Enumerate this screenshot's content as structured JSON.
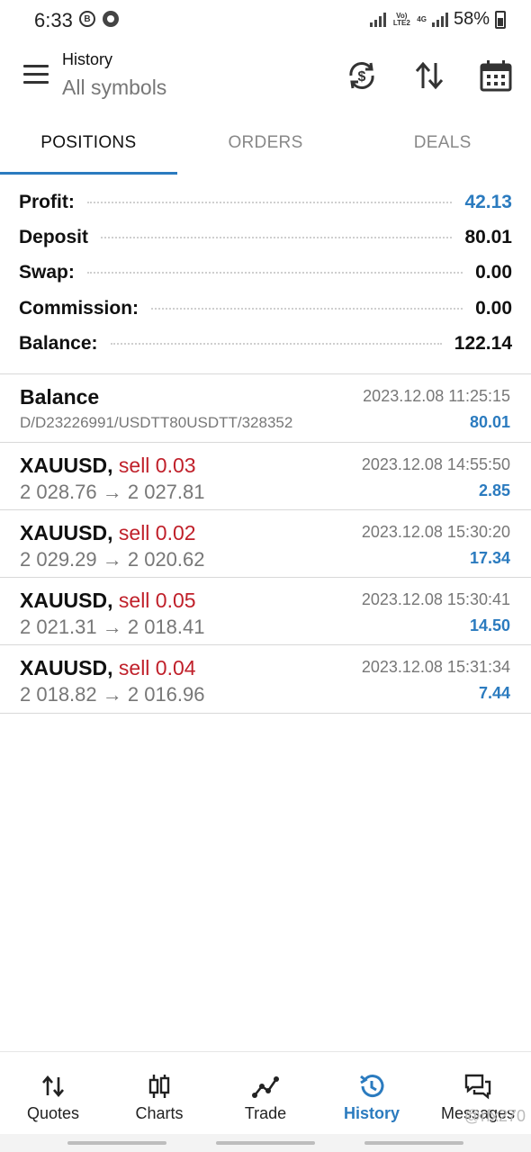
{
  "status_bar": {
    "time": "6:33",
    "net_label_1": "Vo) LTE2",
    "net_label_2": "4G",
    "battery": "58%"
  },
  "app_bar": {
    "title": "History",
    "subtitle": "All symbols",
    "icons": [
      "menu-icon",
      "currency-exchange-icon",
      "sort-icon",
      "calendar-icon"
    ]
  },
  "tabs": [
    {
      "label": "POSITIONS",
      "active": true
    },
    {
      "label": "ORDERS",
      "active": false
    },
    {
      "label": "DEALS",
      "active": false
    }
  ],
  "summary": {
    "profit": {
      "label": "Profit:",
      "value": "42.13"
    },
    "deposit": {
      "label": "Deposit",
      "value": "80.01"
    },
    "swap": {
      "label": "Swap:",
      "value": "0.00"
    },
    "commission": {
      "label": "Commission:",
      "value": "0.00"
    },
    "balance": {
      "label": "Balance:",
      "value": "122.14"
    }
  },
  "deals": [
    {
      "symbol": "Balance",
      "side": "",
      "detail": "D/D23226991/USDTT80USDTT/328352",
      "time": "2023.12.08 11:25:15",
      "profit": "80.01"
    },
    {
      "symbol": "XAUUSD,",
      "side": "sell 0.03",
      "detail": "2 028.76 → 2 027.81",
      "time": "2023.12.08 14:55:50",
      "profit": "2.85"
    },
    {
      "symbol": "XAUUSD,",
      "side": "sell 0.02",
      "detail": "2 029.29 → 2 020.62",
      "time": "2023.12.08 15:30:20",
      "profit": "17.34"
    },
    {
      "symbol": "XAUUSD,",
      "side": "sell 0.05",
      "detail": "2 021.31 → 2 018.41",
      "time": "2023.12.08 15:30:41",
      "profit": "14.50"
    },
    {
      "symbol": "XAUUSD,",
      "side": "sell 0.04",
      "detail": "2 018.82 → 2 016.96",
      "time": "2023.12.08 15:31:34",
      "profit": "7.44"
    }
  ],
  "bottom_nav": [
    {
      "label": "Quotes",
      "icon": "quotes-icon",
      "active": false
    },
    {
      "label": "Charts",
      "icon": "candlestick-icon",
      "active": false
    },
    {
      "label": "Trade",
      "icon": "trade-line-icon",
      "active": false
    },
    {
      "label": "History",
      "icon": "history-icon",
      "active": true
    },
    {
      "label": "Messages",
      "icon": "messages-icon",
      "active": false
    }
  ],
  "watermark": "@rfx270",
  "colors": {
    "accent": "#2b7bbf",
    "sell": "#c0202a",
    "muted": "#777777"
  }
}
